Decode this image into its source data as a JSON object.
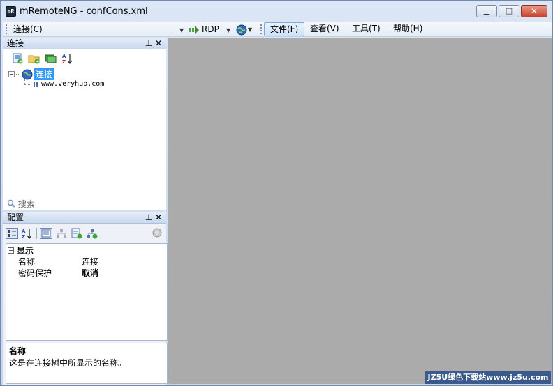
{
  "window": {
    "title": "mRemoteNG - confCons.xml",
    "app_icon_text": "mR"
  },
  "toolbar": {
    "connect_label": "连接(C)",
    "protocol_label": "RDP"
  },
  "menu": [
    {
      "label": "文件(F)",
      "active": true
    },
    {
      "label": "查看(V)",
      "active": false
    },
    {
      "label": "工具(T)",
      "active": false
    },
    {
      "label": "帮助(H)",
      "active": false
    }
  ],
  "connections_panel": {
    "title": "连接",
    "tree": {
      "root_label": "连接",
      "child_label": "www.veryhuo.com"
    },
    "search_placeholder": "搜索"
  },
  "config_panel": {
    "title": "配置",
    "section_label": "显示",
    "properties": [
      {
        "name": "名称",
        "value": "连接"
      },
      {
        "name": "密码保护",
        "value": "取消"
      }
    ],
    "description": {
      "title": "名称",
      "text": "这是在连接树中所显示的名称。"
    }
  },
  "watermark": "JZ5U绿色下载站www.jz5u.com",
  "colors": {
    "workarea": "#ababab",
    "selection": "#3399ff"
  }
}
